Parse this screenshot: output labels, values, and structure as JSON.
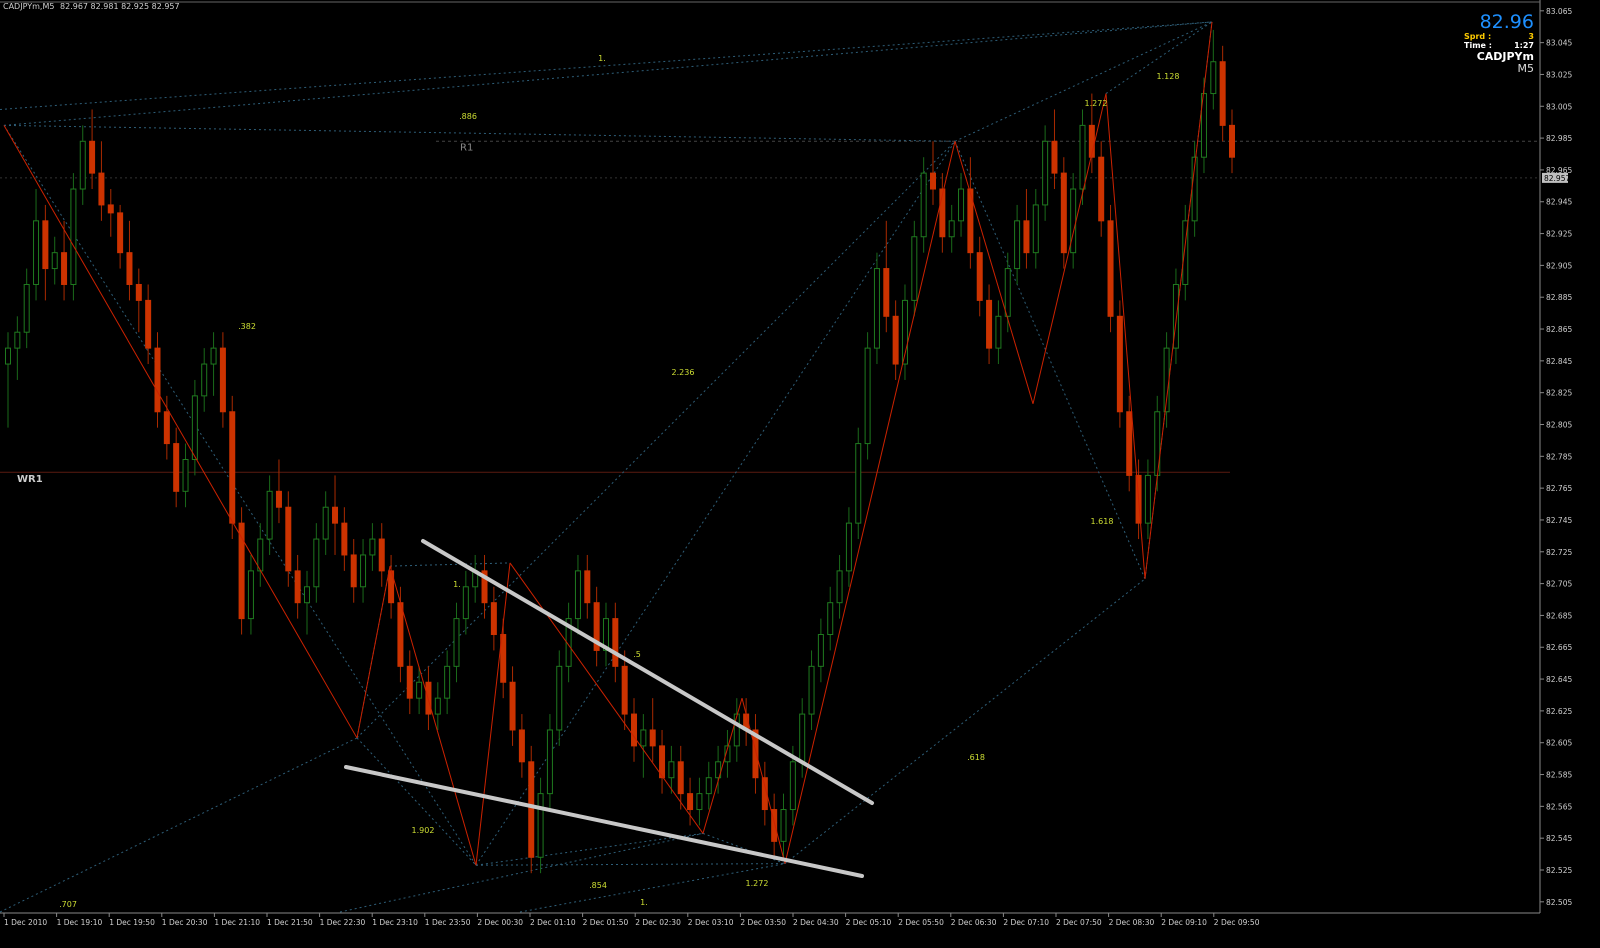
{
  "header": {
    "symbol_line": "CADJPYm,M5",
    "ohlc": "82.967 82.981 82.925 82.957"
  },
  "info_panel": {
    "price": "82.96",
    "spread_label": "Sprd :",
    "spread_value": "3",
    "time_label": "Time :",
    "time_value": "1:27",
    "symbol": "CADJPYm",
    "timeframe": "M5"
  },
  "colors": {
    "background": "#000000",
    "bull_candle": "#1f7a1f",
    "bear_candle": "#cc3300",
    "zigzag": "#cc2200",
    "fib_lines": "#2e5e78",
    "ratio_text": "#ccdd33",
    "trendline": "#c8c8c8",
    "level_line": "#444444"
  },
  "chart_data": {
    "type": "candlestick",
    "ylim": [
      82.5,
      83.06
    ],
    "y_ticks": [
      "83.065",
      "83.045",
      "83.025",
      "83.005",
      "82.985",
      "82.965",
      "82.945",
      "82.925",
      "82.905",
      "82.885",
      "82.865",
      "82.845",
      "82.825",
      "82.805",
      "82.785",
      "82.765",
      "82.745",
      "82.725",
      "82.705",
      "82.685",
      "82.665",
      "82.645",
      "82.625",
      "82.605",
      "82.585",
      "82.565",
      "82.545",
      "82.525",
      "82.505"
    ],
    "current_price_label": "82.957",
    "x_ticks": [
      "1 Dec 2010",
      "1 Dec 19:10",
      "1 Dec 19:50",
      "1 Dec 20:30",
      "1 Dec 21:10",
      "1 Dec 21:50",
      "1 Dec 22:30",
      "1 Dec 23:10",
      "1 Dec 23:50",
      "2 Dec 00:30",
      "2 Dec 01:10",
      "2 Dec 01:50",
      "2 Dec 02:30",
      "2 Dec 03:10",
      "2 Dec 03:50",
      "2 Dec 04:30",
      "2 Dec 05:10",
      "2 Dec 05:50",
      "2 Dec 06:30",
      "2 Dec 07:10",
      "2 Dec 07:50",
      "2 Dec 08:30",
      "2 Dec 09:10",
      "2 Dec 09:50"
    ],
    "levels": [
      {
        "label": "R1",
        "value": 82.98
      },
      {
        "label": "WR1",
        "value": 82.772
      }
    ],
    "zigzag_pivots": [
      82.99,
      82.605,
      82.713,
      82.525,
      82.715,
      82.545,
      82.63,
      82.526,
      82.98,
      82.815,
      83.01,
      82.705,
      83.055
    ],
    "fib_ratios": [
      ".886",
      "1.",
      ".382",
      "2.236",
      "1.272",
      "1.128",
      "1.618",
      ".618",
      ".5",
      "1.",
      "1.902",
      ".707",
      ".854",
      "1.",
      "1.272"
    ],
    "candles": [
      [
        82.84,
        82.86,
        82.8,
        82.85
      ],
      [
        82.85,
        82.87,
        82.83,
        82.86
      ],
      [
        82.86,
        82.9,
        82.85,
        82.89
      ],
      [
        82.89,
        82.95,
        82.88,
        82.93
      ],
      [
        82.93,
        82.94,
        82.88,
        82.9
      ],
      [
        82.9,
        82.92,
        82.89,
        82.91
      ],
      [
        82.91,
        82.93,
        82.88,
        82.89
      ],
      [
        82.89,
        82.96,
        82.88,
        82.95
      ],
      [
        82.95,
        82.99,
        82.94,
        82.98
      ],
      [
        82.98,
        83.0,
        82.95,
        82.96
      ],
      [
        82.96,
        82.98,
        82.93,
        82.94
      ],
      [
        82.94,
        82.95,
        82.92,
        82.935
      ],
      [
        82.935,
        82.94,
        82.9,
        82.91
      ],
      [
        82.91,
        82.93,
        82.88,
        82.89
      ],
      [
        82.89,
        82.9,
        82.86,
        82.88
      ],
      [
        82.88,
        82.89,
        82.84,
        82.85
      ],
      [
        82.85,
        82.86,
        82.8,
        82.81
      ],
      [
        82.81,
        82.82,
        82.78,
        82.79
      ],
      [
        82.79,
        82.8,
        82.75,
        82.76
      ],
      [
        82.76,
        82.79,
        82.75,
        82.78
      ],
      [
        82.78,
        82.83,
        82.77,
        82.82
      ],
      [
        82.82,
        82.85,
        82.81,
        82.84
      ],
      [
        82.84,
        82.86,
        82.82,
        82.85
      ],
      [
        82.85,
        82.86,
        82.8,
        82.81
      ],
      [
        82.81,
        82.82,
        82.73,
        82.74
      ],
      [
        82.74,
        82.75,
        82.67,
        82.68
      ],
      [
        82.68,
        82.72,
        82.67,
        82.71
      ],
      [
        82.71,
        82.74,
        82.7,
        82.73
      ],
      [
        82.73,
        82.77,
        82.72,
        82.76
      ],
      [
        82.76,
        82.78,
        82.74,
        82.75
      ],
      [
        82.75,
        82.76,
        82.7,
        82.71
      ],
      [
        82.71,
        82.72,
        82.68,
        82.69
      ],
      [
        82.69,
        82.71,
        82.67,
        82.7
      ],
      [
        82.7,
        82.74,
        82.69,
        82.73
      ],
      [
        82.73,
        82.76,
        82.72,
        82.75
      ],
      [
        82.75,
        82.77,
        82.72,
        82.74
      ],
      [
        82.74,
        82.75,
        82.71,
        82.72
      ],
      [
        82.72,
        82.73,
        82.69,
        82.7
      ],
      [
        82.7,
        82.73,
        82.69,
        82.72
      ],
      [
        82.72,
        82.74,
        82.71,
        82.73
      ],
      [
        82.73,
        82.74,
        82.7,
        82.71
      ],
      [
        82.71,
        82.72,
        82.68,
        82.69
      ],
      [
        82.69,
        82.7,
        82.64,
        82.65
      ],
      [
        82.65,
        82.66,
        82.62,
        82.63
      ],
      [
        82.63,
        82.65,
        82.62,
        82.64
      ],
      [
        82.64,
        82.65,
        82.61,
        82.62
      ],
      [
        82.62,
        82.64,
        82.61,
        82.63
      ],
      [
        82.63,
        82.66,
        82.62,
        82.65
      ],
      [
        82.65,
        82.69,
        82.64,
        82.68
      ],
      [
        82.68,
        82.71,
        82.67,
        82.7
      ],
      [
        82.7,
        82.72,
        82.69,
        82.71
      ],
      [
        82.71,
        82.72,
        82.68,
        82.69
      ],
      [
        82.69,
        82.7,
        82.66,
        82.67
      ],
      [
        82.67,
        82.68,
        82.63,
        82.64
      ],
      [
        82.64,
        82.65,
        82.6,
        82.61
      ],
      [
        82.61,
        82.62,
        82.58,
        82.59
      ],
      [
        82.59,
        82.6,
        82.52,
        82.53
      ],
      [
        82.53,
        82.58,
        82.52,
        82.57
      ],
      [
        82.57,
        82.62,
        82.56,
        82.61
      ],
      [
        82.61,
        82.66,
        82.6,
        82.65
      ],
      [
        82.65,
        82.69,
        82.64,
        82.68
      ],
      [
        82.68,
        82.72,
        82.67,
        82.71
      ],
      [
        82.71,
        82.72,
        82.68,
        82.69
      ],
      [
        82.69,
        82.7,
        82.65,
        82.66
      ],
      [
        82.66,
        82.69,
        82.65,
        82.68
      ],
      [
        82.68,
        82.69,
        82.64,
        82.65
      ],
      [
        82.65,
        82.66,
        82.61,
        82.62
      ],
      [
        82.62,
        82.63,
        82.59,
        82.6
      ],
      [
        82.6,
        82.62,
        82.58,
        82.61
      ],
      [
        82.61,
        82.63,
        82.59,
        82.6
      ],
      [
        82.6,
        82.61,
        82.57,
        82.58
      ],
      [
        82.58,
        82.6,
        82.57,
        82.59
      ],
      [
        82.59,
        82.6,
        82.56,
        82.57
      ],
      [
        82.57,
        82.58,
        82.55,
        82.56
      ],
      [
        82.56,
        82.58,
        82.55,
        82.57
      ],
      [
        82.57,
        82.59,
        82.56,
        82.58
      ],
      [
        82.58,
        82.6,
        82.57,
        82.59
      ],
      [
        82.59,
        82.61,
        82.58,
        82.6
      ],
      [
        82.6,
        82.63,
        82.59,
        82.62
      ],
      [
        82.62,
        82.63,
        82.6,
        82.61
      ],
      [
        82.61,
        82.62,
        82.57,
        82.58
      ],
      [
        82.58,
        82.59,
        82.55,
        82.56
      ],
      [
        82.56,
        82.57,
        82.53,
        82.54
      ],
      [
        82.54,
        82.57,
        82.53,
        82.56
      ],
      [
        82.56,
        82.6,
        82.55,
        82.59
      ],
      [
        82.59,
        82.63,
        82.58,
        82.62
      ],
      [
        82.62,
        82.66,
        82.61,
        82.65
      ],
      [
        82.65,
        82.68,
        82.64,
        82.67
      ],
      [
        82.67,
        82.7,
        82.66,
        82.69
      ],
      [
        82.69,
        82.72,
        82.68,
        82.71
      ],
      [
        82.71,
        82.75,
        82.7,
        82.74
      ],
      [
        82.74,
        82.8,
        82.73,
        82.79
      ],
      [
        82.79,
        82.86,
        82.78,
        82.85
      ],
      [
        82.85,
        82.91,
        82.84,
        82.9
      ],
      [
        82.9,
        82.93,
        82.86,
        82.87
      ],
      [
        82.87,
        82.88,
        82.83,
        82.84
      ],
      [
        82.84,
        82.89,
        82.83,
        82.88
      ],
      [
        82.88,
        82.93,
        82.87,
        82.92
      ],
      [
        82.92,
        82.97,
        82.91,
        82.96
      ],
      [
        82.96,
        82.98,
        82.94,
        82.95
      ],
      [
        82.95,
        82.96,
        82.91,
        82.92
      ],
      [
        82.92,
        82.94,
        82.91,
        82.93
      ],
      [
        82.93,
        82.96,
        82.92,
        82.95
      ],
      [
        82.95,
        82.97,
        82.9,
        82.91
      ],
      [
        82.91,
        82.92,
        82.87,
        82.88
      ],
      [
        82.88,
        82.89,
        82.84,
        82.85
      ],
      [
        82.85,
        82.88,
        82.84,
        82.87
      ],
      [
        82.87,
        82.91,
        82.86,
        82.9
      ],
      [
        82.9,
        82.94,
        82.89,
        82.93
      ],
      [
        82.93,
        82.95,
        82.9,
        82.91
      ],
      [
        82.91,
        82.95,
        82.9,
        82.94
      ],
      [
        82.94,
        82.99,
        82.93,
        82.98
      ],
      [
        82.98,
        83.0,
        82.95,
        82.96
      ],
      [
        82.96,
        82.97,
        82.9,
        82.91
      ],
      [
        82.91,
        82.96,
        82.9,
        82.95
      ],
      [
        82.95,
        83.0,
        82.94,
        82.99
      ],
      [
        82.99,
        83.01,
        82.96,
        82.97
      ],
      [
        82.97,
        82.98,
        82.92,
        82.93
      ],
      [
        82.93,
        82.94,
        82.86,
        82.87
      ],
      [
        82.87,
        82.88,
        82.8,
        82.81
      ],
      [
        82.81,
        82.82,
        82.76,
        82.77
      ],
      [
        82.77,
        82.78,
        82.73,
        82.74
      ],
      [
        82.74,
        82.78,
        82.73,
        82.77
      ],
      [
        82.77,
        82.82,
        82.76,
        82.81
      ],
      [
        82.81,
        82.86,
        82.8,
        82.85
      ],
      [
        82.85,
        82.9,
        82.84,
        82.89
      ],
      [
        82.89,
        82.94,
        82.88,
        82.93
      ],
      [
        82.93,
        82.98,
        82.92,
        82.97
      ],
      [
        82.97,
        83.02,
        82.96,
        83.01
      ],
      [
        83.01,
        83.05,
        83.0,
        83.03
      ],
      [
        83.03,
        83.04,
        82.98,
        82.99
      ],
      [
        82.99,
        83.0,
        82.96,
        82.97
      ]
    ]
  }
}
